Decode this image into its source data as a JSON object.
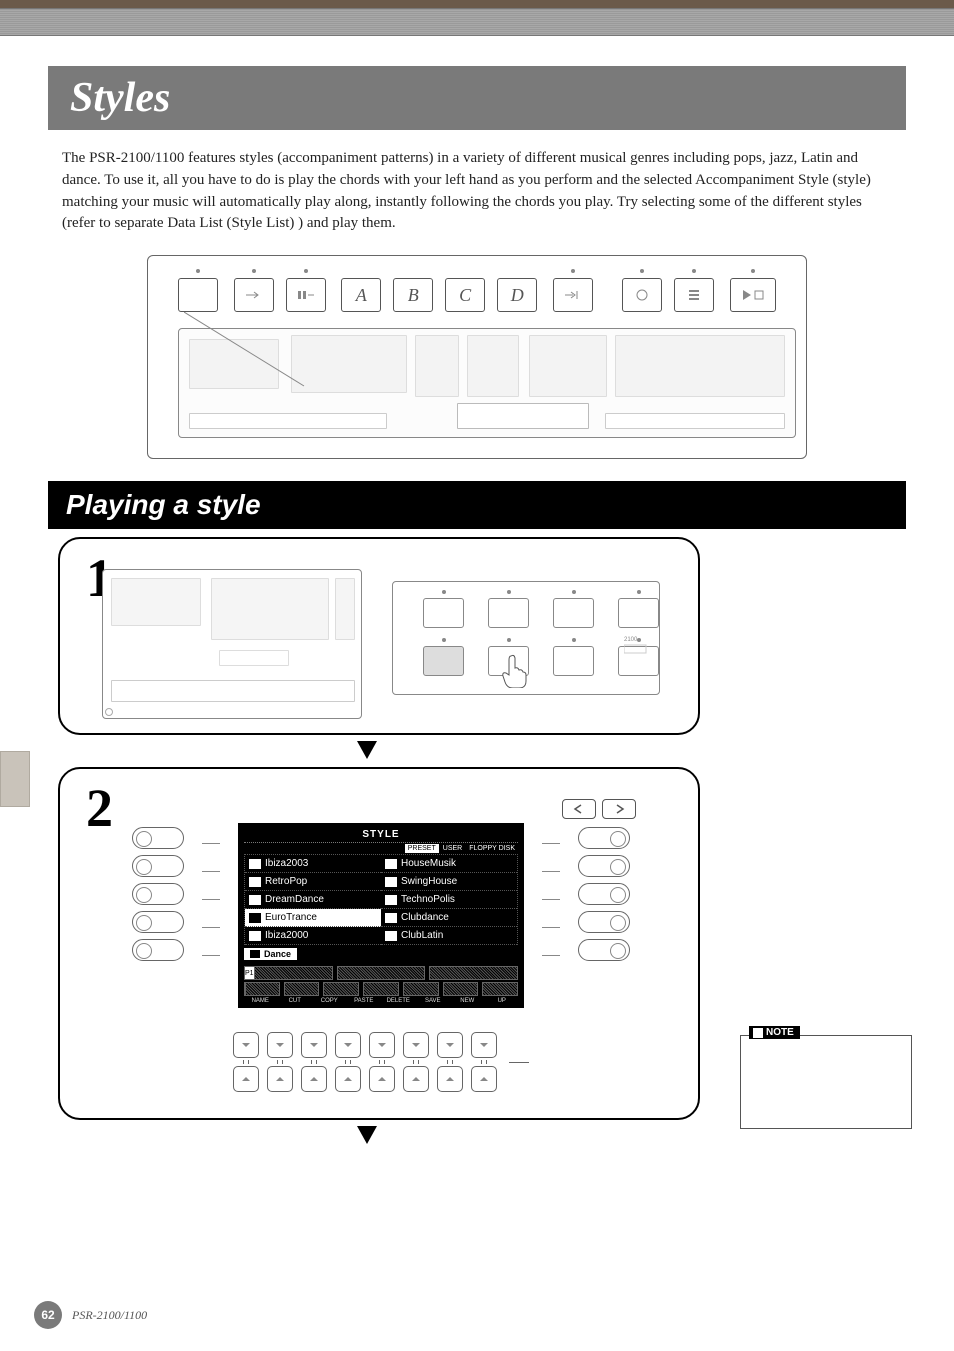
{
  "page": {
    "number": "62",
    "model": "PSR-2100/1100"
  },
  "title": "Styles",
  "intro": "The PSR-2100/1100 features styles (accompaniment patterns) in a variety of different musical genres including pops, jazz, Latin and dance. To use it, all you have to do is play the chords with your left hand as you perform and the selected Accompaniment Style (style) matching your music will automatically play along, instantly following the chords you play. Try selecting some of the different styles (refer to separate Data List (Style List) ) and play them.",
  "section_heading": "Playing a style",
  "step_numbers": {
    "one": "1",
    "two": "2"
  },
  "note_label": "NOTE",
  "lcd": {
    "title": "STYLE",
    "tabs": [
      "PRESET",
      "USER",
      "FLOPPY DISK"
    ],
    "active_tab": 0,
    "left": [
      "Ibiza2003",
      "RetroPop",
      "DreamDance",
      "EuroTrance",
      "Ibiza2000"
    ],
    "right": [
      "HouseMusik",
      "SwingHouse",
      "TechnoPolis",
      "Clubdance",
      "ClubLatin"
    ],
    "selected_row": 3,
    "category": "Dance",
    "page_indicator": "P1",
    "footer_labels": [
      "NAME",
      "CUT",
      "COPY",
      "PASTE",
      "DELETE",
      "SAVE",
      "NEW",
      "UP"
    ]
  },
  "back_next": {
    "back": "◁",
    "next": "▷"
  },
  "top_panel_buttons": [
    "",
    "",
    "A",
    "B",
    "C",
    "D",
    "",
    "",
    "",
    ""
  ]
}
